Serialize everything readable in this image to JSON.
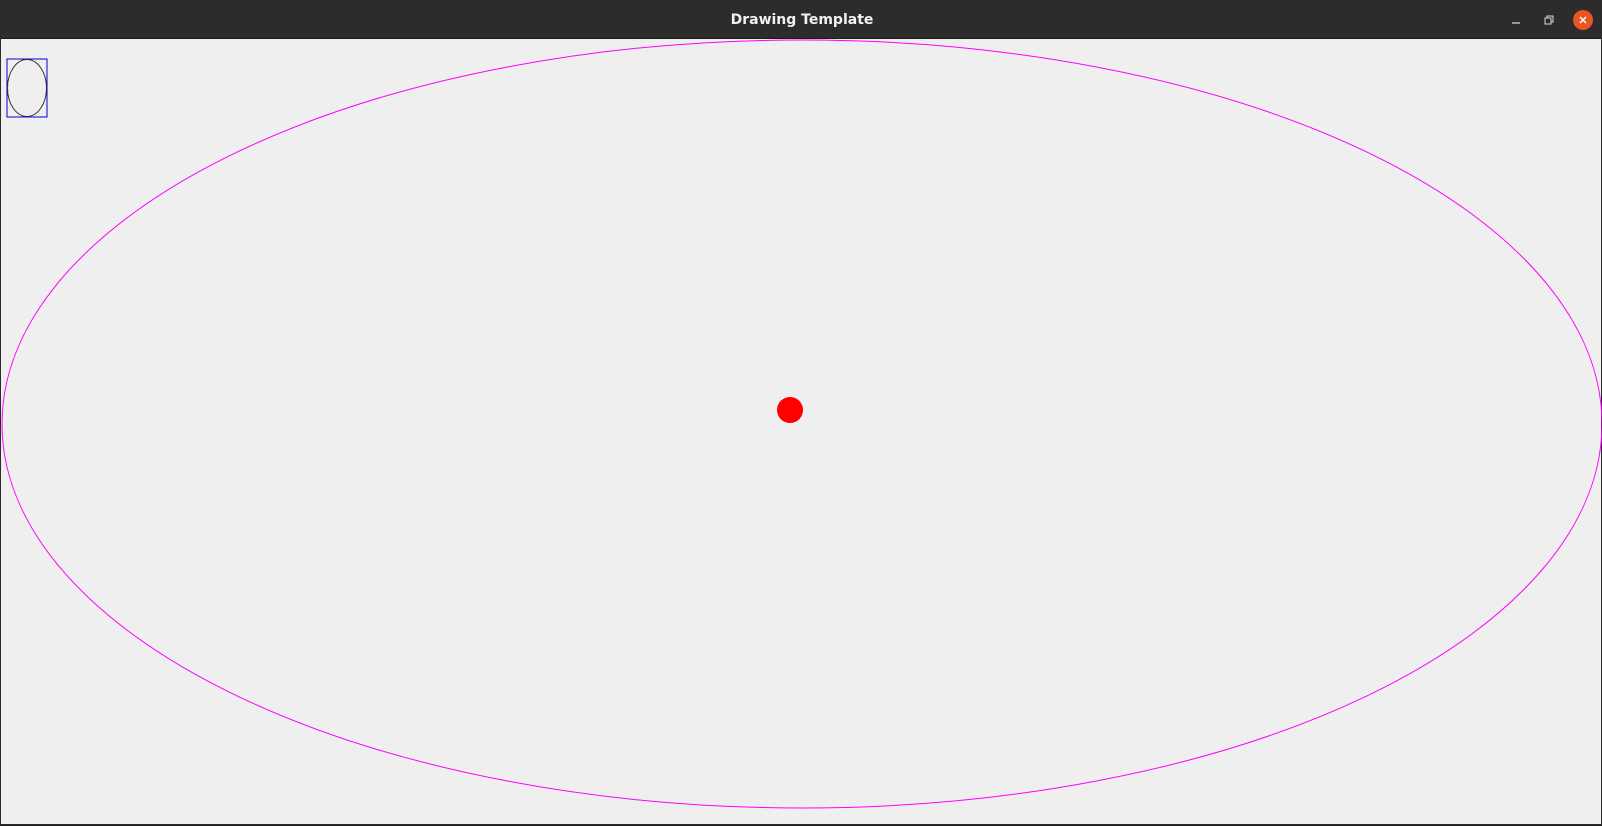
{
  "window": {
    "title": "Drawing Template",
    "controls": {
      "minimize_icon": "minimize-icon",
      "maximize_icon": "restore-icon",
      "close_icon": "close-icon"
    }
  },
  "colors": {
    "titlebar": "#2c2c2c",
    "canvas_background": "#efefef",
    "large_ellipse_stroke": "#ff00ff",
    "center_dot_fill": "#ff0000",
    "thumbnail_frame_stroke": "#0000cc",
    "thumbnail_ellipse_stroke": "#333333",
    "close_button": "#e95420"
  },
  "canvas": {
    "shapes": [
      "thumbnail-frame",
      "thumbnail-ellipse",
      "large-ellipse",
      "center-dot"
    ]
  }
}
